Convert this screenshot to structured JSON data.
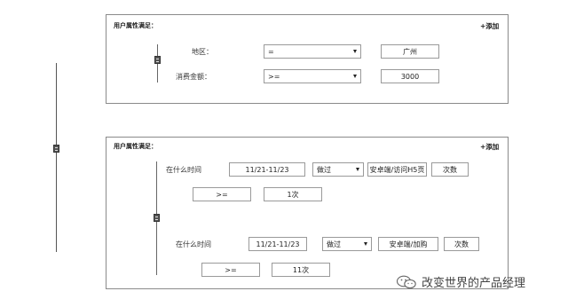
{
  "panel1": {
    "title": "用户属性满足：",
    "add_label": "+添加",
    "rows": [
      {
        "label": "地区：",
        "operator": "=",
        "value": "广州"
      },
      {
        "label": "消费金额：",
        "operator": ">=",
        "value": "3000"
      }
    ]
  },
  "panel2": {
    "title": "用户属性满足：",
    "add_label": "+添加",
    "groups": [
      {
        "label": "在什么时间",
        "date": "11/21-11/23",
        "action": "做过",
        "event": "安卓端/访问H5页",
        "metric": "次数",
        "compare": ">=",
        "count": "1次"
      },
      {
        "label": "在什么时间",
        "date": "11/21-11/23",
        "action": "做过",
        "event": "安卓端/加购",
        "metric": "次数",
        "compare": ">=",
        "count": "11次"
      }
    ]
  },
  "watermark": {
    "text": "改变世界的产品经理",
    "icon": "wechat-icon"
  }
}
